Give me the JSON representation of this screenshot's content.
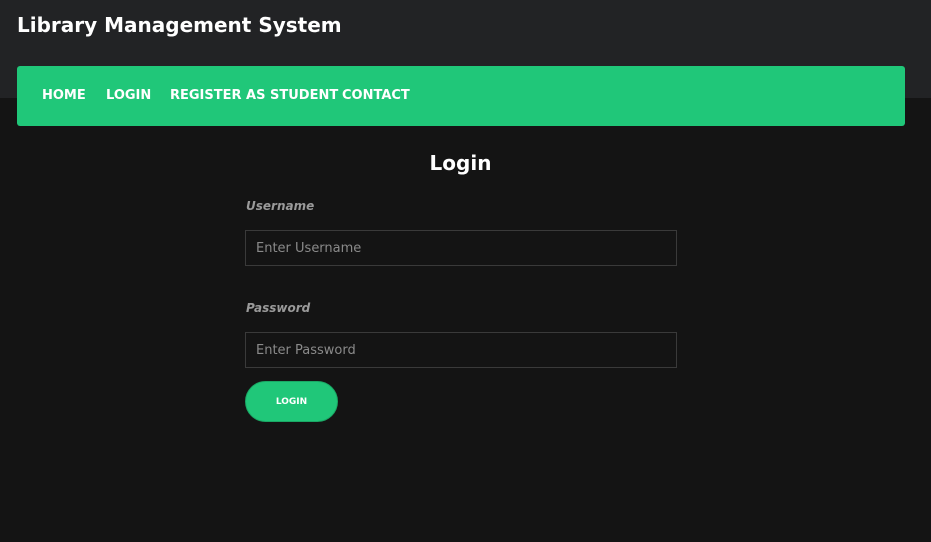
{
  "header": {
    "title": "Library Management System"
  },
  "nav": {
    "items": [
      {
        "label": "HOME"
      },
      {
        "label": "LOGIN"
      },
      {
        "label": "REGISTER AS STUDENT"
      },
      {
        "label": "CONTACT"
      }
    ]
  },
  "login_form": {
    "heading": "Login",
    "username": {
      "label": "Username",
      "placeholder": "Enter Username",
      "value": ""
    },
    "password": {
      "label": "Password",
      "placeholder": "Enter Password",
      "value": ""
    },
    "submit_label": "LOGIN"
  },
  "colors": {
    "accent": "#20c779",
    "header_bg": "#222325",
    "page_bg": "#141414"
  }
}
